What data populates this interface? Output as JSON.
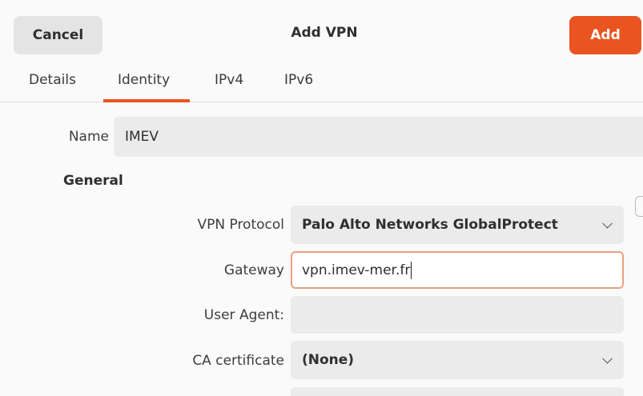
{
  "header": {
    "cancel_label": "Cancel",
    "title": "Add VPN",
    "add_label": "Add"
  },
  "tabs": [
    {
      "label": "Details",
      "active": false
    },
    {
      "label": "Identity",
      "active": true
    },
    {
      "label": "IPv4",
      "active": false
    },
    {
      "label": "IPv6",
      "active": false
    }
  ],
  "identity": {
    "name_label": "Name",
    "name_value": "IMEV",
    "section_general": "General",
    "vpn_protocol_label": "VPN Protocol",
    "vpn_protocol_value": "Palo Alto Networks GlobalProtect",
    "gateway_label": "Gateway",
    "gateway_value": "vpn.imev-mer.fr",
    "user_agent_label": "User Agent:",
    "user_agent_value": "",
    "ca_certificate_label": "CA certificate",
    "ca_certificate_value": "(None)"
  },
  "colors": {
    "accent": "#e95420",
    "focus_border": "#e9a07f",
    "field_bg": "#ebebeb"
  }
}
